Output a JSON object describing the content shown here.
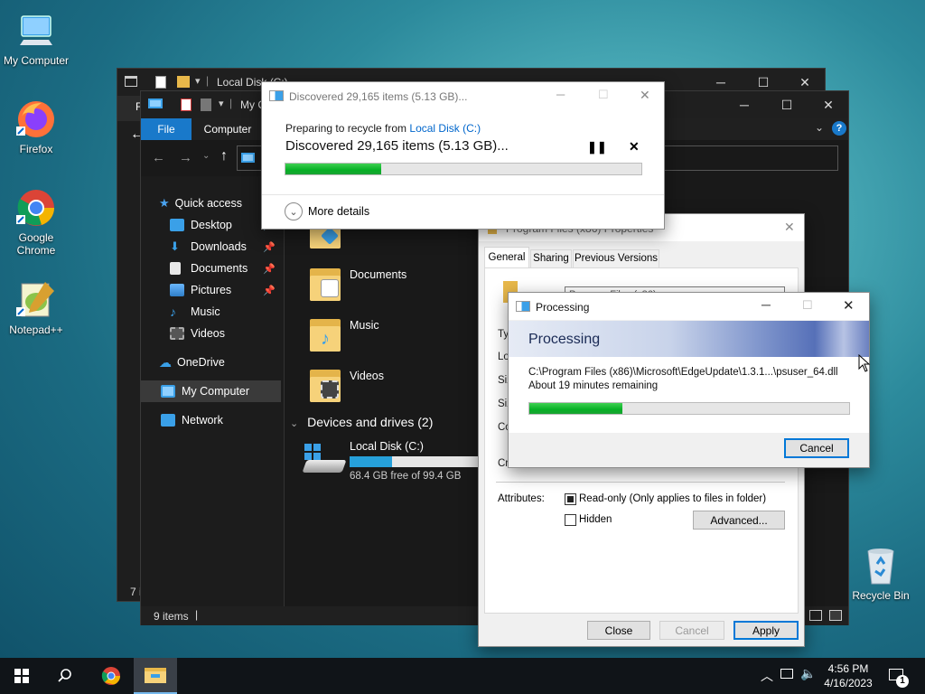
{
  "desktop": {
    "icons": [
      {
        "label": "My Computer",
        "icon": "monitor-icon"
      },
      {
        "label": "Firefox",
        "icon": "firefox-icon"
      },
      {
        "label": "Google Chrome",
        "icon": "chrome-icon"
      },
      {
        "label": "Notepad++",
        "icon": "notepadpp-icon"
      },
      {
        "label": "Recycle Bin",
        "icon": "recycle-bin-icon"
      }
    ]
  },
  "explorer_back": {
    "title": "Local Disk (C:)",
    "status_partial": "7 i",
    "ribbon_partial": "F"
  },
  "explorer_front": {
    "title_partial": "My C",
    "ribbon_tabs": [
      "File",
      "Computer"
    ],
    "nav": [
      {
        "label": "Quick access",
        "icon": "star-icon"
      },
      {
        "label": "Desktop",
        "icon": "desktop-folder-icon",
        "pinned": true
      },
      {
        "label": "Downloads",
        "icon": "download-arrow-icon",
        "pinned": true
      },
      {
        "label": "Documents",
        "icon": "document-icon",
        "pinned": true
      },
      {
        "label": "Pictures",
        "icon": "pictures-icon",
        "pinned": true
      },
      {
        "label": "Music",
        "icon": "music-note-icon"
      },
      {
        "label": "Videos",
        "icon": "film-icon"
      },
      {
        "label": "OneDrive",
        "icon": "cloud-icon"
      },
      {
        "label": "My Computer",
        "icon": "monitor-icon"
      },
      {
        "label": "Network",
        "icon": "network-icon"
      }
    ],
    "folders": [
      "Documents",
      "Music",
      "Videos"
    ],
    "drives_header": "Devices and drives (2)",
    "drive": {
      "name": "Local Disk (C:)",
      "free_text": "68.4 GB free of 99.4 GB",
      "used_fraction": 0.31
    },
    "status": "9 items"
  },
  "recycle_dialog": {
    "title": "Discovered 29,165 items (5.13 GB)...",
    "preparing_text": "Preparing to recycle from ",
    "preparing_link": "Local Disk (C:)",
    "headline": "Discovered 29,165 items (5.13 GB)...",
    "progress": 0.27,
    "more_details": "More details"
  },
  "properties_dialog": {
    "title": "Program Files (x86) Properties",
    "tabs": [
      "General",
      "Sharing",
      "Previous Versions"
    ],
    "name_value": "Program Files (x86)",
    "labels_partial": [
      "Ty",
      "Lo",
      "Siz",
      "Siz",
      "Co",
      "Cr"
    ],
    "attributes_label": "Attributes:",
    "readonly_label": "Read-only (Only applies to files in folder)",
    "hidden_label": "Hidden",
    "advanced_button": "Advanced...",
    "buttons": {
      "close": "Close",
      "cancel": "Cancel",
      "apply": "Apply"
    }
  },
  "processing_dialog": {
    "title": "Processing",
    "banner": "Processing",
    "file_path": "C:\\Program Files (x86)\\Microsoft\\EdgeUpdate\\1.3.1...\\psuser_64.dll",
    "remaining": "About 19 minutes remaining",
    "progress": 0.29,
    "cancel_button": "Cancel"
  },
  "taskbar": {
    "time": "4:56 PM",
    "date": "4/16/2023",
    "notification_count": "1"
  },
  "colors": {
    "accent_blue": "#0078d7",
    "progress_green": "#06b025",
    "explorer_dark": "#202020",
    "ribbon_file_tab": "#1979ca"
  }
}
